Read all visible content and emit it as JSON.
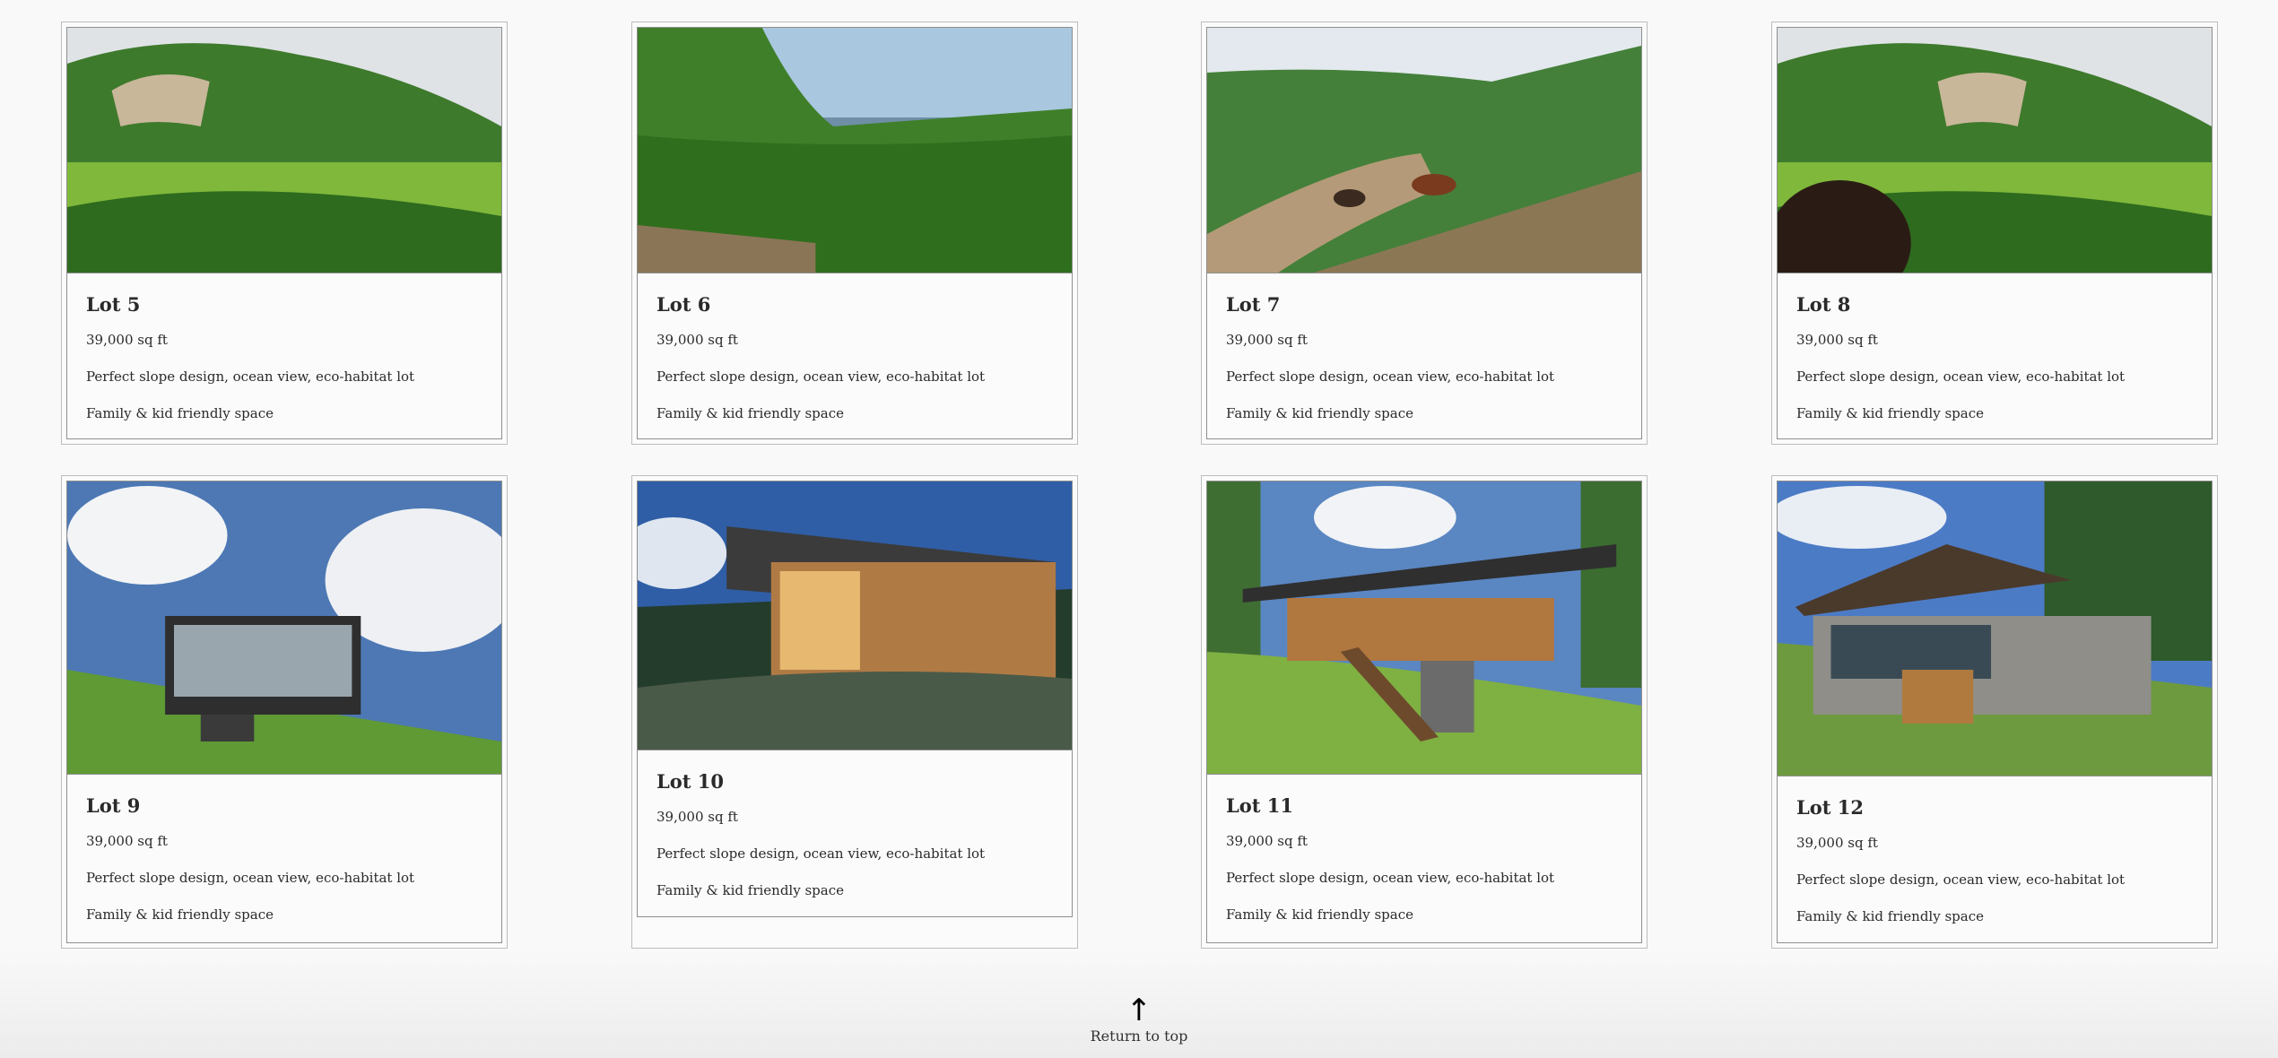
{
  "lots": [
    {
      "title": "Lot 5",
      "size": "39,000 sq ft",
      "desc": "Perfect slope design, ocean view, eco-habitat lot",
      "feature": "Family & kid friendly space",
      "photo": "hillside-landscape"
    },
    {
      "title": "Lot 6",
      "size": "39,000 sq ft",
      "desc": "Perfect slope design, ocean view, eco-habitat lot",
      "feature": "Family & kid friendly space",
      "photo": "jungle-ocean-view"
    },
    {
      "title": "Lot 7",
      "size": "39,000 sq ft",
      "desc": "Perfect slope design, ocean view, eco-habitat lot",
      "feature": "Family & kid friendly space",
      "photo": "horses-trail"
    },
    {
      "title": "Lot 8",
      "size": "39,000 sq ft",
      "desc": "Perfect slope design, ocean view, eco-habitat lot",
      "feature": "Family & kid friendly space",
      "photo": "hillside-landscape-head"
    },
    {
      "title": "Lot 9",
      "size": "39,000 sq ft",
      "desc": "Perfect slope design, ocean view, eco-habitat lot",
      "feature": "Family & kid friendly space",
      "photo": "modern-glass-house"
    },
    {
      "title": "Lot 10",
      "size": "39,000 sq ft",
      "desc": "Perfect slope design, ocean view, eco-habitat lot",
      "feature": "Family & kid friendly space",
      "photo": "wood-house-dusk"
    },
    {
      "title": "Lot 11",
      "size": "39,000 sq ft",
      "desc": "Perfect slope design, ocean view, eco-habitat lot",
      "feature": "Family & kid friendly space",
      "photo": "wood-house-stairs"
    },
    {
      "title": "Lot 12",
      "size": "39,000 sq ft",
      "desc": "Perfect slope design, ocean view, eco-habitat lot",
      "feature": "Family & kid friendly space",
      "photo": "stone-house-lawn"
    }
  ],
  "return_link": {
    "arrow": "↑",
    "label": "Return to top"
  }
}
